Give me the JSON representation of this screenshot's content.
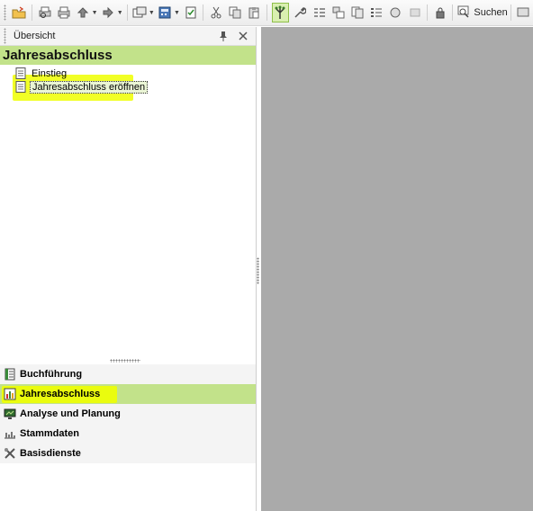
{
  "toolbar": {
    "buttons": [
      {
        "icon": "folder-open-icon"
      },
      {
        "icon": "print-preview-icon"
      },
      {
        "icon": "print-icon"
      },
      {
        "icon": "arrow-up-icon",
        "dropdown": true
      },
      {
        "icon": "arrow-right-icon",
        "dropdown": true
      },
      {
        "icon": "export-icon",
        "dropdown": true
      },
      {
        "icon": "calculator-icon",
        "dropdown": true
      },
      {
        "icon": "checklist-icon"
      },
      {
        "icon": "cut-icon"
      },
      {
        "icon": "copy-icon"
      },
      {
        "icon": "paste-icon"
      },
      {
        "icon": "tree-icon",
        "active": true
      },
      {
        "icon": "wrench-icon"
      },
      {
        "icon": "indent-list-icon"
      },
      {
        "icon": "windows-icon"
      },
      {
        "icon": "document-copy-icon"
      },
      {
        "icon": "list-icon"
      },
      {
        "icon": "circle-icon"
      },
      {
        "icon": "box-icon"
      },
      {
        "icon": "lock-icon"
      }
    ],
    "search_label": "Suchen"
  },
  "panel": {
    "header_title": "Übersicht",
    "section_title": "Jahresabschluss",
    "tree_items": [
      {
        "label": "Einstieg",
        "selected": false
      },
      {
        "label": "Jahresabschluss eröffnen",
        "selected": true
      }
    ]
  },
  "nav": {
    "items": [
      {
        "label": "Buchführung",
        "icon": "ledger-icon",
        "active": false
      },
      {
        "label": "Jahresabschluss",
        "icon": "annual-report-icon",
        "active": true
      },
      {
        "label": "Analyse und Planung",
        "icon": "monitor-chart-icon",
        "active": false
      },
      {
        "label": "Stammdaten",
        "icon": "master-data-icon",
        "active": false
      },
      {
        "label": "Basisdienste",
        "icon": "tools-icon",
        "active": false
      }
    ]
  },
  "colors": {
    "accent_green": "#c2e28a",
    "highlight_yellow": "#eeff00",
    "workspace_gray": "#aaaaaa"
  }
}
